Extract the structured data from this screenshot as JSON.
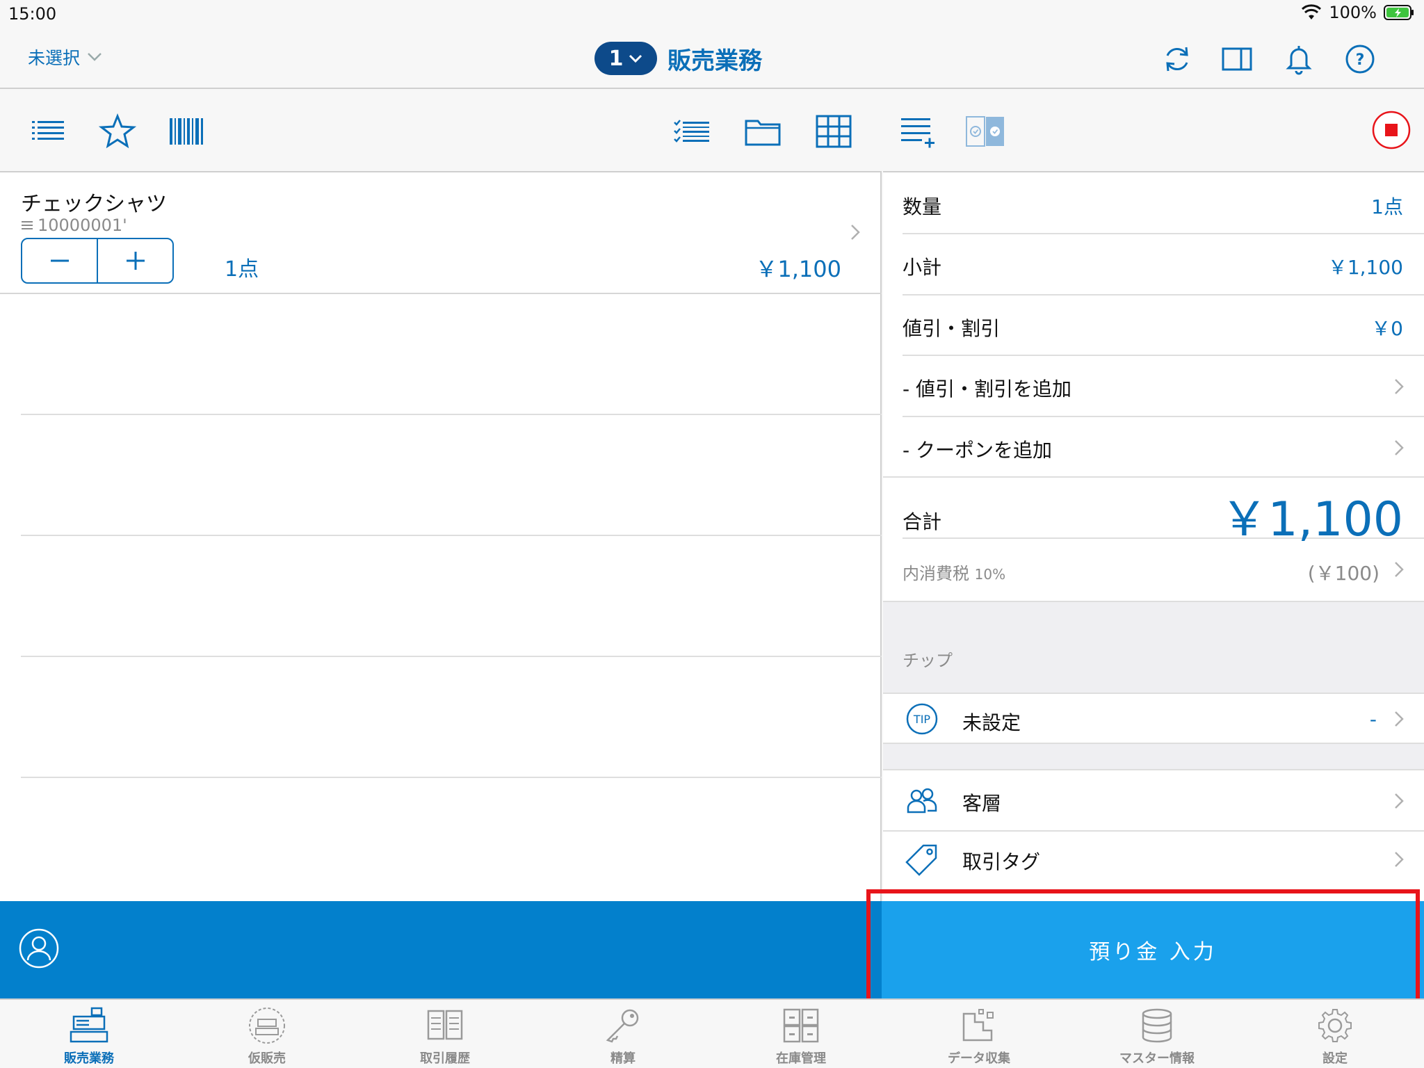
{
  "status": {
    "time": "15:00",
    "battery": "100%"
  },
  "nav": {
    "store_select": "未選択",
    "register_number": "1",
    "title": "販売業務"
  },
  "item": {
    "name": "チェックシャツ",
    "code": "10000001'",
    "qty": "1点",
    "price": "￥1,100"
  },
  "summary": {
    "quantity_label": "数量",
    "quantity_value": "1点",
    "subtotal_label": "小計",
    "subtotal_value": "￥1,100",
    "discount_label": "値引・割引",
    "discount_value": "￥0",
    "add_discount_label": "- 値引・割引を追加",
    "add_coupon_label": "- クーポンを追加",
    "total_label": "合計",
    "total_value": "￥1,100",
    "tax_label": "内消費税",
    "tax_rate": "10%",
    "tax_value": "(￥100)"
  },
  "tip": {
    "header": "チップ",
    "label": "未設定",
    "value": "-"
  },
  "customer_segment_label": "客層",
  "transaction_tag_label": "取引タグ",
  "deposit_button_label": "預り金 入力",
  "tabs": [
    {
      "label": "販売業務",
      "active": true
    },
    {
      "label": "仮販売"
    },
    {
      "label": "取引履歴"
    },
    {
      "label": "精算"
    },
    {
      "label": "在庫管理"
    },
    {
      "label": "データ収集"
    },
    {
      "label": "マスター情報"
    },
    {
      "label": "設定"
    }
  ]
}
